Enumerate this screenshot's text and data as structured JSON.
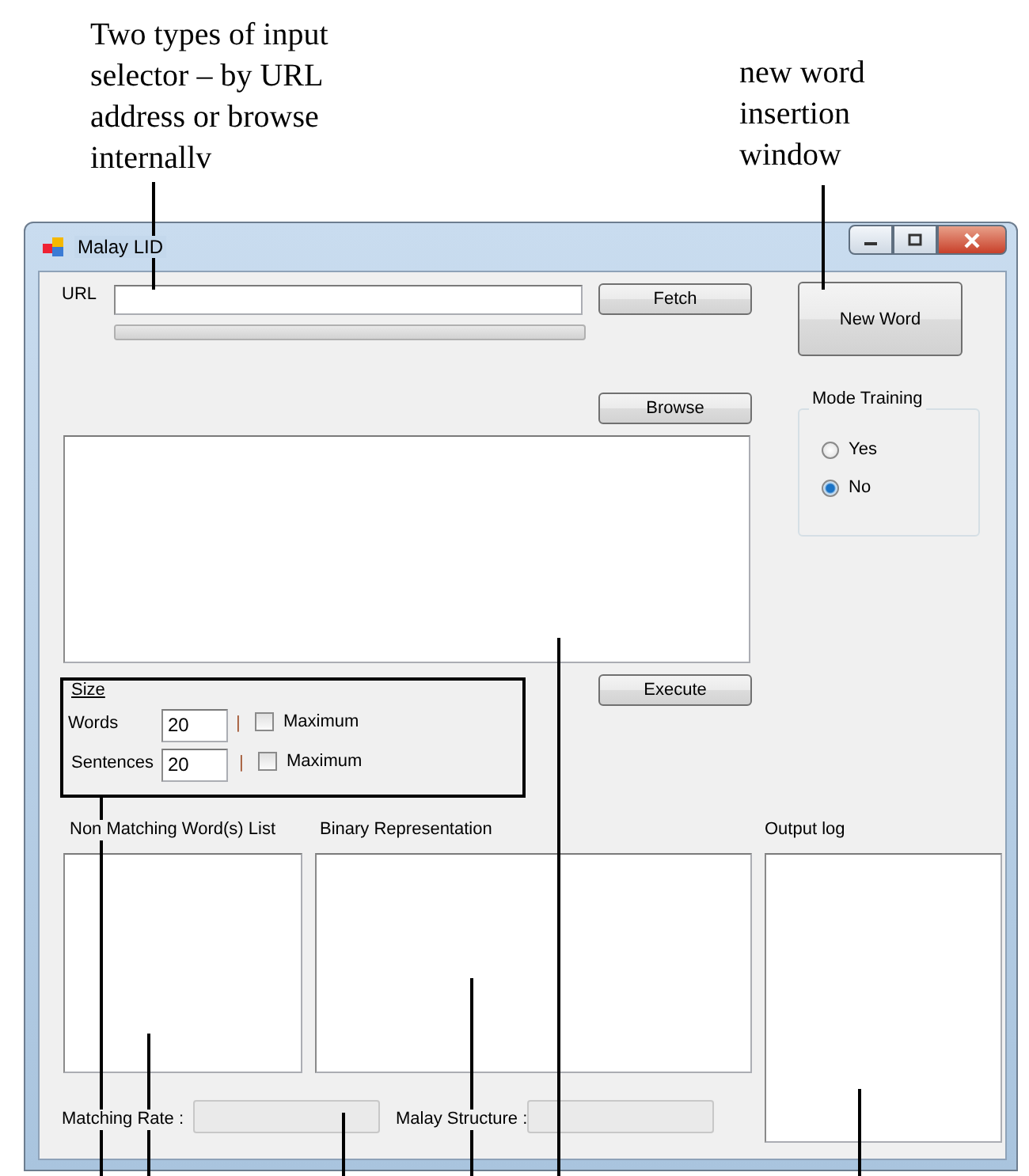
{
  "annotations": [
    {
      "text": "Two types of input\nselector – by URL\naddress or browse\ninternallv"
    },
    {
      "text": "new word\ninsertion\nwindow"
    }
  ],
  "window": {
    "title": "Malay LID"
  },
  "url": {
    "label": "URL"
  },
  "progress": {
    "level": 0
  },
  "buttons": {
    "fetch": "Fetch",
    "new_word": "New Word",
    "browse": "Browse",
    "execute": "Execute"
  },
  "mode_training": {
    "title": "Mode Training",
    "options": [
      {
        "label": "Yes",
        "selected": false
      },
      {
        "label": "No",
        "selected": true
      }
    ]
  },
  "size": {
    "title": "Size",
    "rows": [
      {
        "label": "Words",
        "value": "20",
        "separator": "|",
        "checkbox_label": "Maximum",
        "checked": false
      },
      {
        "label": "Sentences",
        "value": "20",
        "separator": "|",
        "checkbox_label": "Maximum",
        "checked": false
      }
    ]
  },
  "panels": {
    "non_matching": "Non Matching Word(s) List",
    "binary": "Binary Representation",
    "output_log": "Output log"
  },
  "stats": {
    "matching_rate": "Matching Rate :",
    "malay_structure": "Malay Structure :"
  }
}
